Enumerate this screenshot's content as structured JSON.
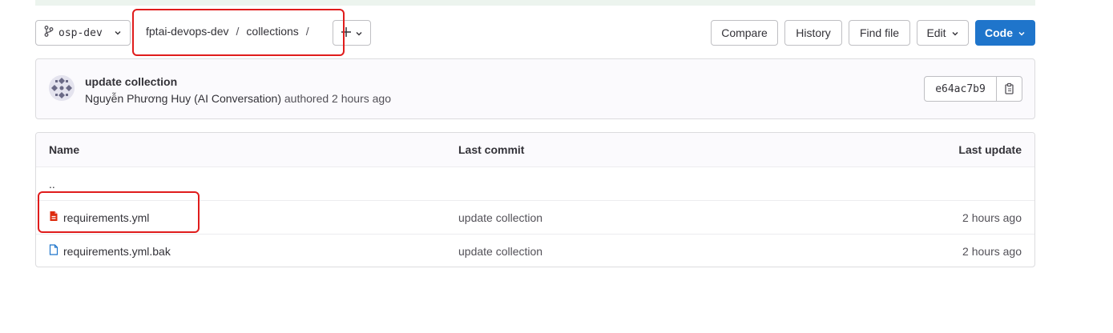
{
  "toolbar": {
    "branch": "osp-dev",
    "breadcrumb": [
      "fptai-devops-dev",
      "collections"
    ],
    "separator": "/",
    "compare": "Compare",
    "history": "History",
    "find_file": "Find file",
    "edit": "Edit",
    "code": "Code"
  },
  "commit": {
    "title": "update collection",
    "author": "Nguyễn Phương Huy (AI Conversation)",
    "authored": "authored 2 hours ago",
    "sha": "e64ac7b9"
  },
  "table": {
    "headers": {
      "name": "Name",
      "last_commit": "Last commit",
      "last_update": "Last update"
    },
    "parent": "..",
    "rows": [
      {
        "name": "requirements.yml",
        "commit": "update collection",
        "updated": "2 hours ago",
        "icon": "file-yaml-icon"
      },
      {
        "name": "requirements.yml.bak",
        "commit": "update collection",
        "updated": "2 hours ago",
        "icon": "file-icon"
      }
    ]
  },
  "colors": {
    "primary": "#1f75cb",
    "annotation": "#e01c1c",
    "yaml_icon": "#dd2b0e",
    "file_icon": "#1f75cb"
  }
}
